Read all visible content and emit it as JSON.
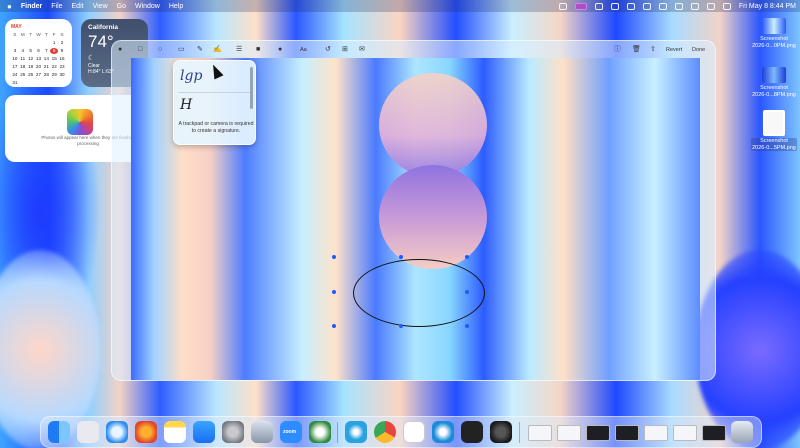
{
  "menubar": {
    "app_name": "Finder",
    "menus": [
      "File",
      "Edit",
      "View",
      "Go",
      "Window",
      "Help"
    ],
    "datetime": "Fri May 8  8:44 PM"
  },
  "calendar_widget": {
    "month": "MAY",
    "weekdays": [
      "S",
      "M",
      "T",
      "W",
      "T",
      "F",
      "S"
    ],
    "weeks": [
      [
        "",
        "",
        "",
        "",
        "",
        "1",
        "2"
      ],
      [
        "3",
        "4",
        "5",
        "6",
        "7",
        "8",
        "9"
      ],
      [
        "10",
        "11",
        "12",
        "13",
        "14",
        "15",
        "16"
      ],
      [
        "17",
        "18",
        "19",
        "20",
        "21",
        "22",
        "23"
      ],
      [
        "24",
        "25",
        "26",
        "27",
        "28",
        "29",
        "30"
      ],
      [
        "31",
        "",
        "",
        "",
        "",
        "",
        ""
      ]
    ],
    "today": "8"
  },
  "weather_widget": {
    "city": "California",
    "temp": "74°",
    "condition": "Clear",
    "high_low": "H:84° L:63°"
  },
  "photos_widget": {
    "message": "Photos will appear here when they are finished processing"
  },
  "markup_toolbar": {
    "shapes_label": "Aa",
    "revert_label": "Revert",
    "done_label": "Done"
  },
  "signature_popover": {
    "sig1": "lgp",
    "sig2": "H",
    "message": "A trackpad or camera is required to create a signature."
  },
  "desktop_files": [
    {
      "name_line1": "Screenshot",
      "name_line2": "2026-0...0PM.png"
    },
    {
      "name_line1": "Screenshot",
      "name_line2": "2026-0...8PM.png"
    },
    {
      "name_line1": "Screenshot",
      "name_line2": "2026-0...5PM.png"
    }
  ],
  "dock": {
    "zoom_label": "zoom"
  }
}
